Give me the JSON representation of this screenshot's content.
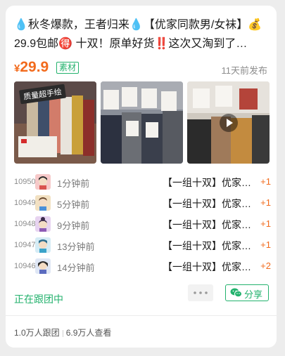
{
  "post": {
    "title": "💧秋冬爆款，王者归来💧【优家同款男/女袜】💰29.9包邮🉐 十双！原单好货‼️这次又淘到了…",
    "price_currency": "¥",
    "price_value": "29.9",
    "tag": "素材",
    "published": "11天前发布",
    "thumbnail_label": "质量超手绘"
  },
  "orders": [
    {
      "id": "10950",
      "time": "1分钟前",
      "title": "【一组十双】优家同款男/女袜",
      "qty": "+1"
    },
    {
      "id": "10949",
      "time": "5分钟前",
      "title": "【一组十双】优家同款男/女袜",
      "qty": "+1"
    },
    {
      "id": "10948",
      "time": "9分钟前",
      "title": "【一组十双】优家同款男/女袜",
      "qty": "+1"
    },
    {
      "id": "10947",
      "time": "13分钟前",
      "title": "【一组十双】优家同款男/女袜",
      "qty": "+1"
    },
    {
      "id": "10946",
      "time": "14分钟前",
      "title": "【一组十双】优家同款男/女袜",
      "qty": "+2"
    }
  ],
  "footer": {
    "status": "正在跟团中",
    "share_label": "分享",
    "followers": "1.0万人跟团",
    "views": "6.9万人查看"
  },
  "colors": {
    "accent": "#23b26d",
    "price": "#f26b1d"
  }
}
